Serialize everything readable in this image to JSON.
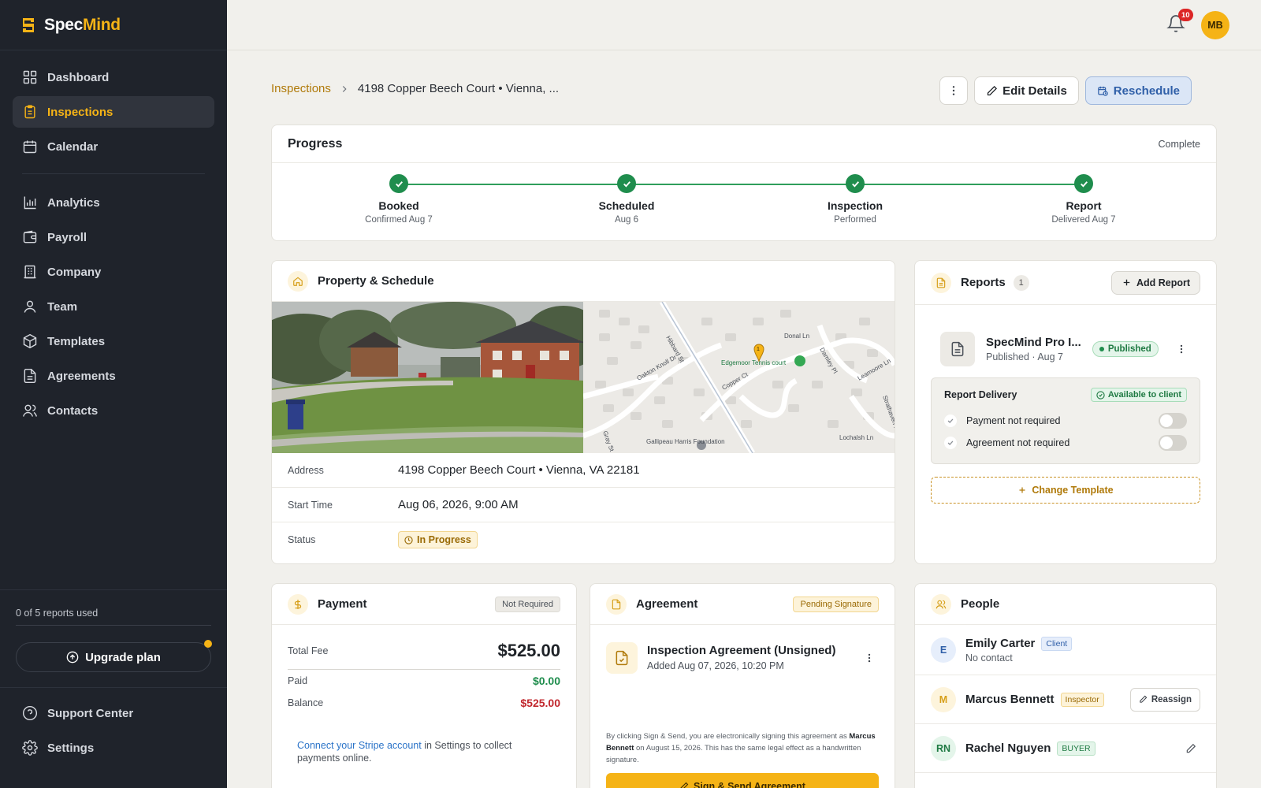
{
  "app": {
    "brand_a": "Spec",
    "brand_b": "Mind",
    "accent": "#f5b316"
  },
  "sidebar": {
    "items": [
      {
        "label": "Dashboard",
        "icon": "grid-icon"
      },
      {
        "label": "Inspections",
        "icon": "clipboard-icon",
        "active": true
      },
      {
        "label": "Calendar",
        "icon": "calendar-icon"
      },
      {
        "label": "Analytics",
        "icon": "bar-chart-icon"
      },
      {
        "label": "Payroll",
        "icon": "wallet-icon"
      },
      {
        "label": "Company",
        "icon": "building-icon"
      },
      {
        "label": "Team",
        "icon": "user-icon"
      },
      {
        "label": "Templates",
        "icon": "box-icon"
      },
      {
        "label": "Agreements",
        "icon": "file-text-icon"
      },
      {
        "label": "Contacts",
        "icon": "users-icon"
      }
    ],
    "usage": "0 of 5 reports used",
    "upgrade": "Upgrade plan",
    "bottom": [
      {
        "label": "Support Center",
        "icon": "help-circle-icon"
      },
      {
        "label": "Settings",
        "icon": "gear-icon"
      }
    ]
  },
  "topbar": {
    "notifications": "10",
    "avatar": "MB"
  },
  "breadcrumb": {
    "parent": "Inspections",
    "current": "4198 Copper Beech Court • Vienna, ..."
  },
  "actions": {
    "edit": "Edit Details",
    "reschedule": "Reschedule"
  },
  "progress": {
    "title": "Progress",
    "status": "Complete",
    "steps": [
      {
        "label": "Booked",
        "sub": "Confirmed Aug 7"
      },
      {
        "label": "Scheduled",
        "sub": "Aug 6"
      },
      {
        "label": "Inspection",
        "sub": "Performed"
      },
      {
        "label": "Report",
        "sub": "Delivered Aug 7"
      }
    ]
  },
  "property": {
    "title": "Property & Schedule",
    "map_labels": {
      "street1": "Hibbard St",
      "street2": "Oakton Knoll Dr",
      "street3": "Copper Ct",
      "street4": "Donal Ln",
      "street5": "Damley Pl",
      "street6": "Leamoore Ln",
      "street7": "Gray St",
      "street8": "Lochalsh Ln",
      "street9": "Strathaven Pl",
      "poi1": "Edgemoor Tennis court",
      "poi2": "Gallipeau Harris Foundation",
      "pin": "1"
    },
    "rows": [
      {
        "label": "Address",
        "value": "4198 Copper Beech Court • Vienna, VA 22181"
      },
      {
        "label": "Start Time",
        "value": "Aug 06, 2026, 9:00 AM"
      },
      {
        "label": "Status",
        "value": "In Progress"
      }
    ]
  },
  "reports": {
    "title": "Reports",
    "count": "1",
    "add": "Add Report",
    "item": {
      "name": "SpecMind Pro I...",
      "sub": "Published · Aug 7",
      "badge": "Published"
    },
    "delivery": {
      "title": "Report Delivery",
      "badge": "Available to client",
      "toggles": [
        {
          "label": "Payment not required",
          "on": false
        },
        {
          "label": "Agreement not required",
          "on": false
        }
      ]
    },
    "change_template": "Change Template"
  },
  "payment": {
    "title": "Payment",
    "badge": "Not Required",
    "total_label": "Total Fee",
    "total": "$525.00",
    "paid_label": "Paid",
    "paid": "$0.00",
    "balance_label": "Balance",
    "balance": "$525.00",
    "stripe_link": "Connect your Stripe account",
    "stripe_rest": " in Settings to collect payments online."
  },
  "agreement": {
    "title": "Agreement",
    "badge": "Pending Signature",
    "name": "Inspection Agreement (Unsigned)",
    "sub": "Added Aug 07, 2026, 10:20 PM",
    "legal_a": "By clicking Sign & Send, you are electronically signing this agreement as ",
    "legal_name": "Marcus Bennett",
    "legal_b": " on August 15, 2026. This has the same legal effect as a handwritten signature.",
    "sign": "Sign & Send Agreement"
  },
  "people": {
    "title": "People",
    "list": [
      {
        "initials": "E",
        "name": "Emily Carter",
        "role": "Client",
        "sub": "No contact"
      },
      {
        "initials": "M",
        "name": "Marcus Bennett",
        "role": "Inspector",
        "action": "Reassign"
      },
      {
        "initials": "RN",
        "name": "Rachel Nguyen",
        "role": "BUYER"
      }
    ]
  }
}
